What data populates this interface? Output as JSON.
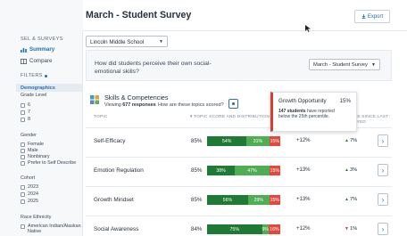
{
  "header": {
    "title": "March - Student Survey",
    "export_label": "Export"
  },
  "sidebar": {
    "section_label": "SEL & SURVEYS",
    "nav": [
      {
        "label": "Summary",
        "active": true
      },
      {
        "label": "Compare",
        "active": false
      }
    ],
    "filters_label": "FILTERS",
    "demographics_label": "Demographics",
    "grade_level": {
      "label": "Grade Level",
      "options": [
        "6",
        "7",
        "8"
      ]
    },
    "gender": {
      "label": "Gender",
      "options": [
        "Female",
        "Male",
        "Nonbinary",
        "Prefer to Self Describe"
      ]
    },
    "cohort": {
      "label": "Cohort",
      "options": [
        "2023",
        "2024",
        "2025"
      ]
    },
    "race": {
      "label": "Race Ethnicity",
      "options": [
        "American Indian/Alaskan Native"
      ]
    }
  },
  "main": {
    "school_select": "Lincoln Middle School",
    "question": "How did students perceive their own social-emotional skills?",
    "survey_select": "March - Student Survey",
    "skills": {
      "title": "Skills & Competencies",
      "viewing_prefix": "Viewing",
      "viewing_count": "677 responses",
      "how_scored": "How are these topics scored?",
      "col_topic": "TOPIC",
      "col_score": "TOPIC SCORE AND DISTRIBUTION",
      "col_change": "CHANGE SINCE LAST SURVEYED"
    },
    "rows": [
      {
        "topic": "Self-Efficacy",
        "score": "85%",
        "segs": [
          {
            "v": 54,
            "label": "54%"
          },
          {
            "v": 31,
            "label": "31%"
          },
          {
            "v": 15,
            "label": "15%"
          }
        ],
        "change": "+12%",
        "trend": "7%",
        "trend_dir": "up"
      },
      {
        "topic": "Emotion Regulation",
        "score": "85%",
        "segs": [
          {
            "v": 38,
            "label": "38%"
          },
          {
            "v": 47,
            "label": "47%"
          },
          {
            "v": 15,
            "label": "15%"
          }
        ],
        "change": "+13%",
        "trend": "3%",
        "trend_dir": "up"
      },
      {
        "topic": "Growth Mindset",
        "score": "85%",
        "segs": [
          {
            "v": 56,
            "label": "56%"
          },
          {
            "v": 29,
            "label": "29%"
          },
          {
            "v": 15,
            "label": "15%"
          }
        ],
        "change": "+13%",
        "trend": "7%",
        "trend_dir": "up"
      },
      {
        "topic": "Social Awareness",
        "score": "84%",
        "segs": [
          {
            "v": 75,
            "label": "75%"
          },
          {
            "v": 9,
            "label": "9%"
          },
          {
            "v": 16,
            "label": "16%"
          }
        ],
        "change": "+12%",
        "trend": "1%",
        "trend_dir": "down"
      }
    ],
    "tooltip": {
      "title": "Growth Opportunity",
      "value": "15%",
      "count": "147 students",
      "desc": "have reported below the 25th percentile."
    }
  },
  "colors": {
    "dark_green": "#1e7a34",
    "light_green": "#4fae54",
    "red": "#e3483f",
    "accent": "#1f6fb5"
  }
}
